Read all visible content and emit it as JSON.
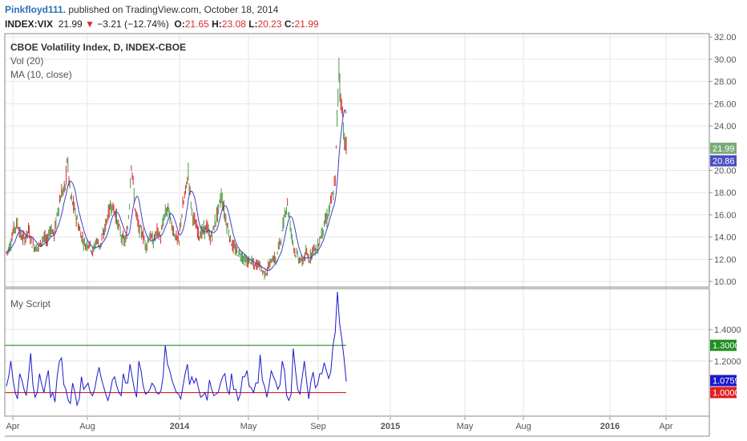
{
  "header": {
    "author": "Pinkfloyd111.",
    "published": " published on TradingView.com, October 18, 2014",
    "symbol": "INDEX:VIX",
    "last": "21.99",
    "arrow": "▼",
    "change": "−3.21 (−12.74%)",
    "o_label": "O:",
    "o_value": "21.65",
    "h_label": "H:",
    "h_value": "23.08",
    "l_label": "L:",
    "l_value": "20.23",
    "c_label": "C:",
    "c_value": "21.99"
  },
  "legend": {
    "title": "CBOE Volatility Index, D, INDEX-CBOE",
    "vol": "Vol (20)",
    "ma": "MA (10, close)",
    "script": "My Script"
  },
  "chart_data": [
    {
      "type": "candlestick",
      "title": "CBOE Volatility Index, D, INDEX-CBOE",
      "ylim": [
        9.5,
        32.3
      ],
      "y_ticks": [
        "32.00",
        "30.00",
        "28.00",
        "26.00",
        "24.00",
        "22.00",
        "20.00",
        "18.00",
        "16.00",
        "14.00",
        "12.00",
        "10.00"
      ],
      "x_ticks": [
        "Apr",
        "Aug",
        "2014",
        "May",
        "Sep",
        "2015",
        "May",
        "Aug",
        "2016",
        "Apr"
      ],
      "last_price_label": "21.99",
      "ma_label": "20.86",
      "colors": {
        "up": "#4a9a4a",
        "down": "#d32f2f",
        "ma": "#3f3fc7",
        "last_tag": "#79ac79",
        "ma_tag": "#4d4dc4"
      },
      "close_path": [
        [
          0,
          12.6
        ],
        [
          4,
          13.2
        ],
        [
          8,
          14.7
        ],
        [
          12,
          15.2
        ],
        [
          16,
          14.0
        ],
        [
          20,
          13.8
        ],
        [
          24,
          14.6
        ],
        [
          28,
          13.4
        ],
        [
          32,
          13.0
        ],
        [
          36,
          13.2
        ],
        [
          40,
          14.0
        ],
        [
          44,
          13.5
        ],
        [
          48,
          14.8
        ],
        [
          52,
          14.2
        ],
        [
          56,
          16.4
        ],
        [
          60,
          17.9
        ],
        [
          64,
          18.4
        ],
        [
          66,
          21.0
        ],
        [
          70,
          17.6
        ],
        [
          74,
          16.5
        ],
        [
          78,
          15.1
        ],
        [
          82,
          14.0
        ],
        [
          86,
          13.2
        ],
        [
          90,
          13.5
        ],
        [
          94,
          12.6
        ],
        [
          98,
          13.7
        ],
        [
          102,
          13.2
        ],
        [
          106,
          14.3
        ],
        [
          110,
          15.8
        ],
        [
          114,
          16.9
        ],
        [
          118,
          16.3
        ],
        [
          122,
          15.0
        ],
        [
          126,
          13.8
        ],
        [
          130,
          13.6
        ],
        [
          132,
          14.8
        ],
        [
          134,
          17.1
        ],
        [
          136,
          20.8
        ],
        [
          140,
          16.6
        ],
        [
          144,
          14.8
        ],
        [
          148,
          14.3
        ],
        [
          152,
          13.2
        ],
        [
          156,
          14.1
        ],
        [
          160,
          13.6
        ],
        [
          164,
          14.5
        ],
        [
          168,
          14.0
        ],
        [
          172,
          15.9
        ],
        [
          176,
          16.6
        ],
        [
          180,
          15.0
        ],
        [
          184,
          14.1
        ],
        [
          188,
          13.5
        ],
        [
          190,
          15.6
        ],
        [
          194,
          17.6
        ],
        [
          198,
          19.7
        ],
        [
          202,
          16.2
        ],
        [
          206,
          15.0
        ],
        [
          210,
          14.2
        ],
        [
          214,
          14.5
        ],
        [
          218,
          14.9
        ],
        [
          222,
          13.8
        ],
        [
          226,
          14.9
        ],
        [
          230,
          16.2
        ],
        [
          234,
          17.7
        ],
        [
          238,
          15.9
        ],
        [
          242,
          14.4
        ],
        [
          246,
          13.2
        ],
        [
          250,
          12.7
        ],
        [
          254,
          12.5
        ],
        [
          258,
          12.1
        ],
        [
          262,
          11.7
        ],
        [
          266,
          11.9
        ],
        [
          270,
          11.3
        ],
        [
          274,
          11.7
        ],
        [
          278,
          11.0
        ],
        [
          282,
          10.7
        ],
        [
          286,
          11.4
        ],
        [
          290,
          12.1
        ],
        [
          294,
          11.9
        ],
        [
          296,
          13.0
        ],
        [
          300,
          14.3
        ],
        [
          304,
          16.5
        ],
        [
          306,
          17.0
        ],
        [
          310,
          14.4
        ],
        [
          314,
          12.7
        ],
        [
          318,
          12.1
        ],
        [
          322,
          11.7
        ],
        [
          326,
          12.5
        ],
        [
          330,
          12.0
        ],
        [
          334,
          13.0
        ],
        [
          338,
          12.8
        ],
        [
          342,
          14.0
        ],
        [
          346,
          15.1
        ],
        [
          350,
          15.9
        ],
        [
          352,
          16.7
        ],
        [
          356,
          17.9
        ],
        [
          358,
          19.2
        ],
        [
          360,
          24.5
        ],
        [
          362,
          29.2
        ],
        [
          364,
          26.3
        ],
        [
          366,
          25.2
        ],
        [
          368,
          22.6
        ],
        [
          370,
          21.99
        ]
      ]
    },
    {
      "type": "line",
      "title": "My Script",
      "ylim": [
        0.85,
        1.66
      ],
      "y_ticks": [
        "1.4000",
        "1.2000"
      ],
      "upper_level": "1.3000",
      "lower_level": "1.0000",
      "last_value": "1.0759",
      "colors": {
        "series": "#1a1acc",
        "upper": "#1f8f1f",
        "lower": "#e02020",
        "last_tag": "#1a1acc"
      },
      "values": [
        1.04,
        1.1,
        1.2,
        1.08,
        1.0,
        0.96,
        1.12,
        1.08,
        1.02,
        0.98,
        1.1,
        1.25,
        1.05,
        0.97,
        1.0,
        1.12,
        1.05,
        1.0,
        1.08,
        1.14,
        0.97,
        1.0,
        0.94,
        1.1,
        1.2,
        1.22,
        1.05,
        1.02,
        0.95,
        0.93,
        1.06,
        1.0,
        0.92,
        0.96,
        1.1,
        1.02,
        1.04,
        1.06,
        1.0,
        0.98,
        1.02,
        1.1,
        1.16,
        1.09,
        1.04,
        0.99,
        0.95,
        1.0,
        1.08,
        1.1,
        1.04,
        1.0,
        0.98,
        1.12,
        1.06,
        1.06,
        1.18,
        1.1,
        1.02,
        0.97,
        1.2,
        1.14,
        1.04,
        0.99,
        1.0,
        1.02,
        1.06,
        1.04,
        1.0,
        0.99,
        1.01,
        1.1,
        1.3,
        1.18,
        1.14,
        1.08,
        1.04,
        1.0,
        0.99,
        0.96,
        1.04,
        1.12,
        1.18,
        1.05,
        1.1,
        1.06,
        1.09,
        1.03,
        0.97,
        0.98,
        1.0,
        0.95,
        1.08,
        1.02,
        0.98,
        0.99,
        1.0,
        1.06,
        1.1,
        1.12,
        1.02,
        0.99,
        1.12,
        1.02,
        1.02,
        0.95,
        0.99,
        1.1,
        1.1,
        1.14,
        1.04,
        1.03,
        1.0,
        1.06,
        1.06,
        1.24,
        1.08,
        1.04,
        0.97,
        1.04,
        1.14,
        1.1,
        1.07,
        1.02,
        1.05,
        1.2,
        1.14,
        0.98,
        0.95,
        0.99,
        1.28,
        1.14,
        1.02,
        0.99,
        1.09,
        1.2,
        1.08,
        0.96,
        1.07,
        1.13,
        1.03,
        1.05,
        1.12,
        1.12,
        1.19,
        1.14,
        1.09,
        1.13,
        1.3,
        1.38,
        1.64,
        1.44,
        1.34,
        1.22,
        1.07
      ]
    }
  ]
}
